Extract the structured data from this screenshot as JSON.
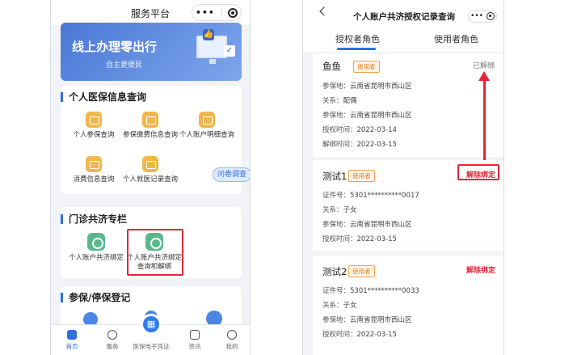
{
  "left": {
    "title": "服务平台",
    "capsule": {
      "dots": "•••"
    },
    "banner": {
      "headline": "线上办理零出行",
      "sub": "自主更便民"
    },
    "sections": {
      "info": {
        "title": "个人医保信息查询",
        "items": [
          "个人参保查询",
          "参保缴费信息查询",
          "个人账户明细查询",
          "消费信息查询",
          "个人就医记录查询"
        ]
      },
      "survey": "问卷调查",
      "clinic": {
        "title": "门诊共济专栏",
        "items": [
          "个人账户共济绑定",
          "个人账户共济绑定查询和解绑"
        ]
      },
      "insure": {
        "title": "参保/停保登记"
      }
    },
    "tabbar": {
      "items": [
        "首页",
        "服务",
        "医保电子凭证",
        "资讯",
        "我的"
      ],
      "center_glyph": "▦"
    }
  },
  "right": {
    "title": "个人账户共济授权记录查询",
    "capsule": {
      "dots": "•••"
    },
    "tabs": [
      "授权者角色",
      "使用者角色"
    ],
    "records": [
      {
        "name": "鱼鱼",
        "badge": "使用者",
        "status": "已解绑",
        "rows": [
          [
            "参保地：",
            "云南省昆明市西山区"
          ],
          [
            "关系：",
            "配偶"
          ],
          [
            "参保地：",
            "云南省昆明市西山区"
          ],
          [
            "授权时间：",
            "2022-03-14"
          ],
          [
            "解绑时间：",
            "2022-03-15"
          ]
        ]
      },
      {
        "name": "测试1",
        "badge": "使用者",
        "action": "解除绑定",
        "rows": [
          [
            "证件号：",
            "5301**********0017"
          ],
          [
            "关系：",
            "子女"
          ],
          [
            "参保地：",
            "云南省昆明市西山区"
          ],
          [
            "授权时间：",
            "2022-03-15"
          ]
        ]
      },
      {
        "name": "测试2",
        "badge": "使用者",
        "action": "解除绑定",
        "rows": [
          [
            "证件号：",
            "5301**********0033"
          ],
          [
            "关系：",
            "子女"
          ],
          [
            "参保地：",
            "云南省昆明市西山区"
          ],
          [
            "授权时间：",
            "2022-03-15"
          ]
        ]
      }
    ]
  },
  "colors": {
    "accent": "#2f6fe0",
    "annotation_red": "#e5263a",
    "badge_orange": "#e0831f"
  }
}
